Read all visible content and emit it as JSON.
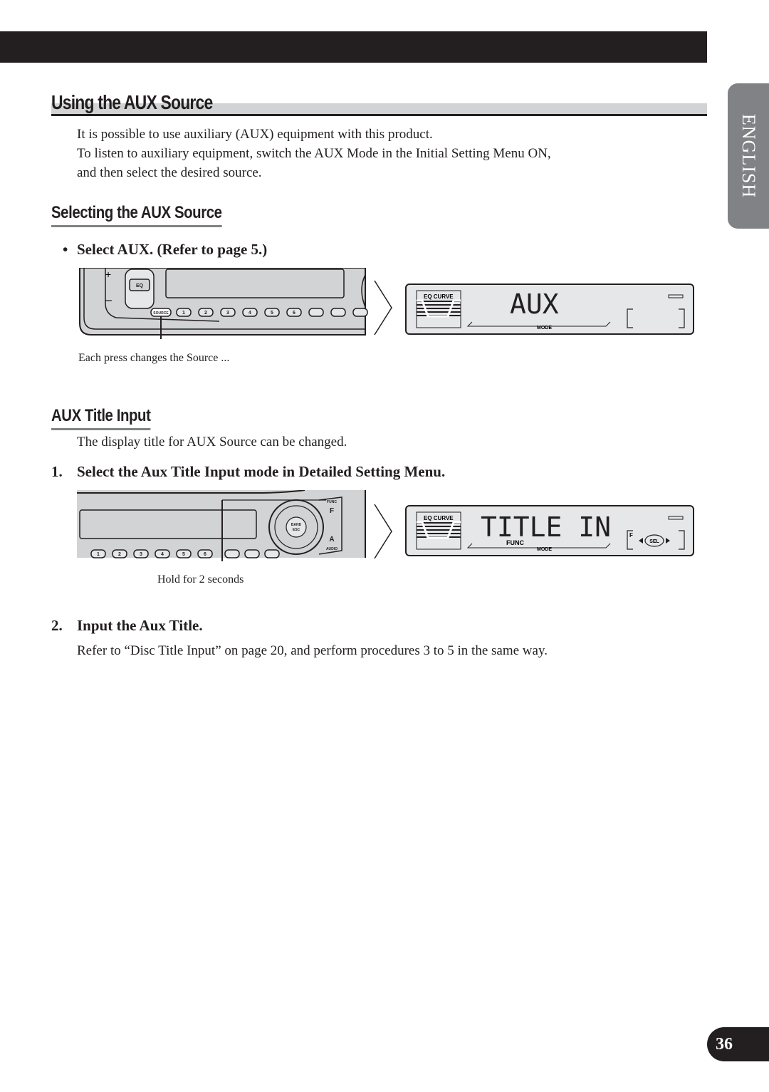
{
  "page": {
    "section_tab": "ENGLISH",
    "page_number": "36"
  },
  "section": {
    "title": "Using the AUX Source",
    "intro": [
      "It is possible to use auxiliary (AUX) equipment with this product.",
      "To listen to auxiliary equipment, switch the AUX Mode in the Initial Setting Menu ON,",
      "and then select the desired source."
    ]
  },
  "selecting": {
    "title": "Selecting the AUX Source",
    "bullet": "•",
    "step": "Select AUX. (Refer to page 5.)",
    "figure": {
      "caption": "Each press changes the Source ...",
      "buttons": [
        "SOURCE",
        "1",
        "2",
        "3",
        "4",
        "5",
        "6"
      ],
      "eq_label": "EQ",
      "display_text": "AUX",
      "eq_curve_label": "EQ CURVE",
      "mode_label": "MODE"
    }
  },
  "title_input": {
    "title": "AUX Title Input",
    "description": "The display title for AUX Source can be changed.",
    "steps": [
      {
        "number": "1.",
        "text": "Select the Aux Title Input mode in Detailed Setting Menu."
      },
      {
        "number": "2.",
        "text": "Input the Aux Title.",
        "detail": "Refer to “Disc Title Input” on page 20, and perform procedures 3 to 5 in the same way."
      }
    ],
    "figure": {
      "caption": "Hold for 2 seconds",
      "buttons": [
        "1",
        "2",
        "3",
        "4",
        "5",
        "6"
      ],
      "func_label": "FUNC",
      "f_label": "F",
      "band_label": "BAND",
      "esc_label": "ESC",
      "audio_label": "AUDIO",
      "a_label": "A",
      "display_text": "TITLE IN",
      "eq_curve_label": "EQ CURVE",
      "lcd_func_label": "FUNC",
      "mode_label": "MODE",
      "sel_label": "SEL",
      "lcd_f_label": "F"
    }
  }
}
